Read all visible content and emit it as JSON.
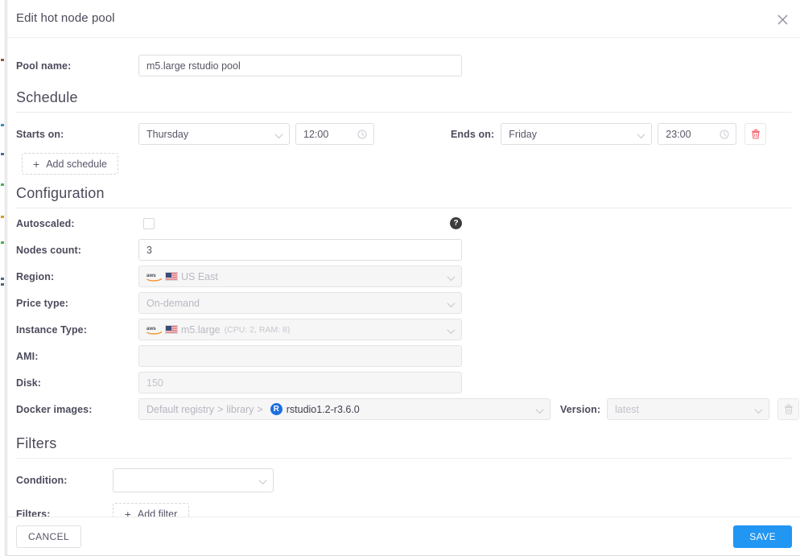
{
  "modal": {
    "title": "Edit hot node pool",
    "close_icon": "close-icon"
  },
  "pool_name": {
    "label": "Pool name:",
    "value": "m5.large rstudio pool"
  },
  "schedule": {
    "heading": "Schedule",
    "starts_label": "Starts on:",
    "start_day": "Thursday",
    "start_time": "12:00",
    "ends_label": "Ends on:",
    "end_day": "Friday",
    "end_time": "23:00",
    "delete_icon": "trash-icon",
    "add_label": "Add schedule",
    "plus": "+"
  },
  "configuration": {
    "heading": "Configuration",
    "autoscaled_label": "Autoscaled:",
    "autoscaled_checked": false,
    "help_icon": "help-icon",
    "nodes_count_label": "Nodes count:",
    "nodes_count": "3",
    "region_label": "Region:",
    "region": "US East",
    "price_type_label": "Price type:",
    "price_type": "On-demand",
    "instance_type_label": "Instance Type:",
    "instance_type": "m5.large",
    "instance_meta": "(CPU: 2, RAM: 8)",
    "ami_label": "AMI:",
    "ami": "",
    "disk_label": "Disk:",
    "disk_placeholder": "150",
    "docker_label": "Docker images:",
    "docker_registry": "Default registry",
    "docker_library": "library",
    "docker_image": "rstudio1.2-r3.6.0",
    "docker_sep": ">",
    "version_label": "Version:",
    "version_value": "latest",
    "version_delete_icon": "trash-icon"
  },
  "filters": {
    "heading": "Filters",
    "condition_label": "Condition:",
    "condition_value": "",
    "filters_label": "Filters:",
    "add_filter_label": "Add filter",
    "plus": "+"
  },
  "footer": {
    "cancel_label": "CANCEL",
    "save_label": "SAVE"
  },
  "colors": {
    "accent": "#2196f3",
    "danger": "#f4606c",
    "label": "#4b4b5c",
    "disabled_bg": "#f6f6f6",
    "top_strip": "#1d5e80"
  }
}
